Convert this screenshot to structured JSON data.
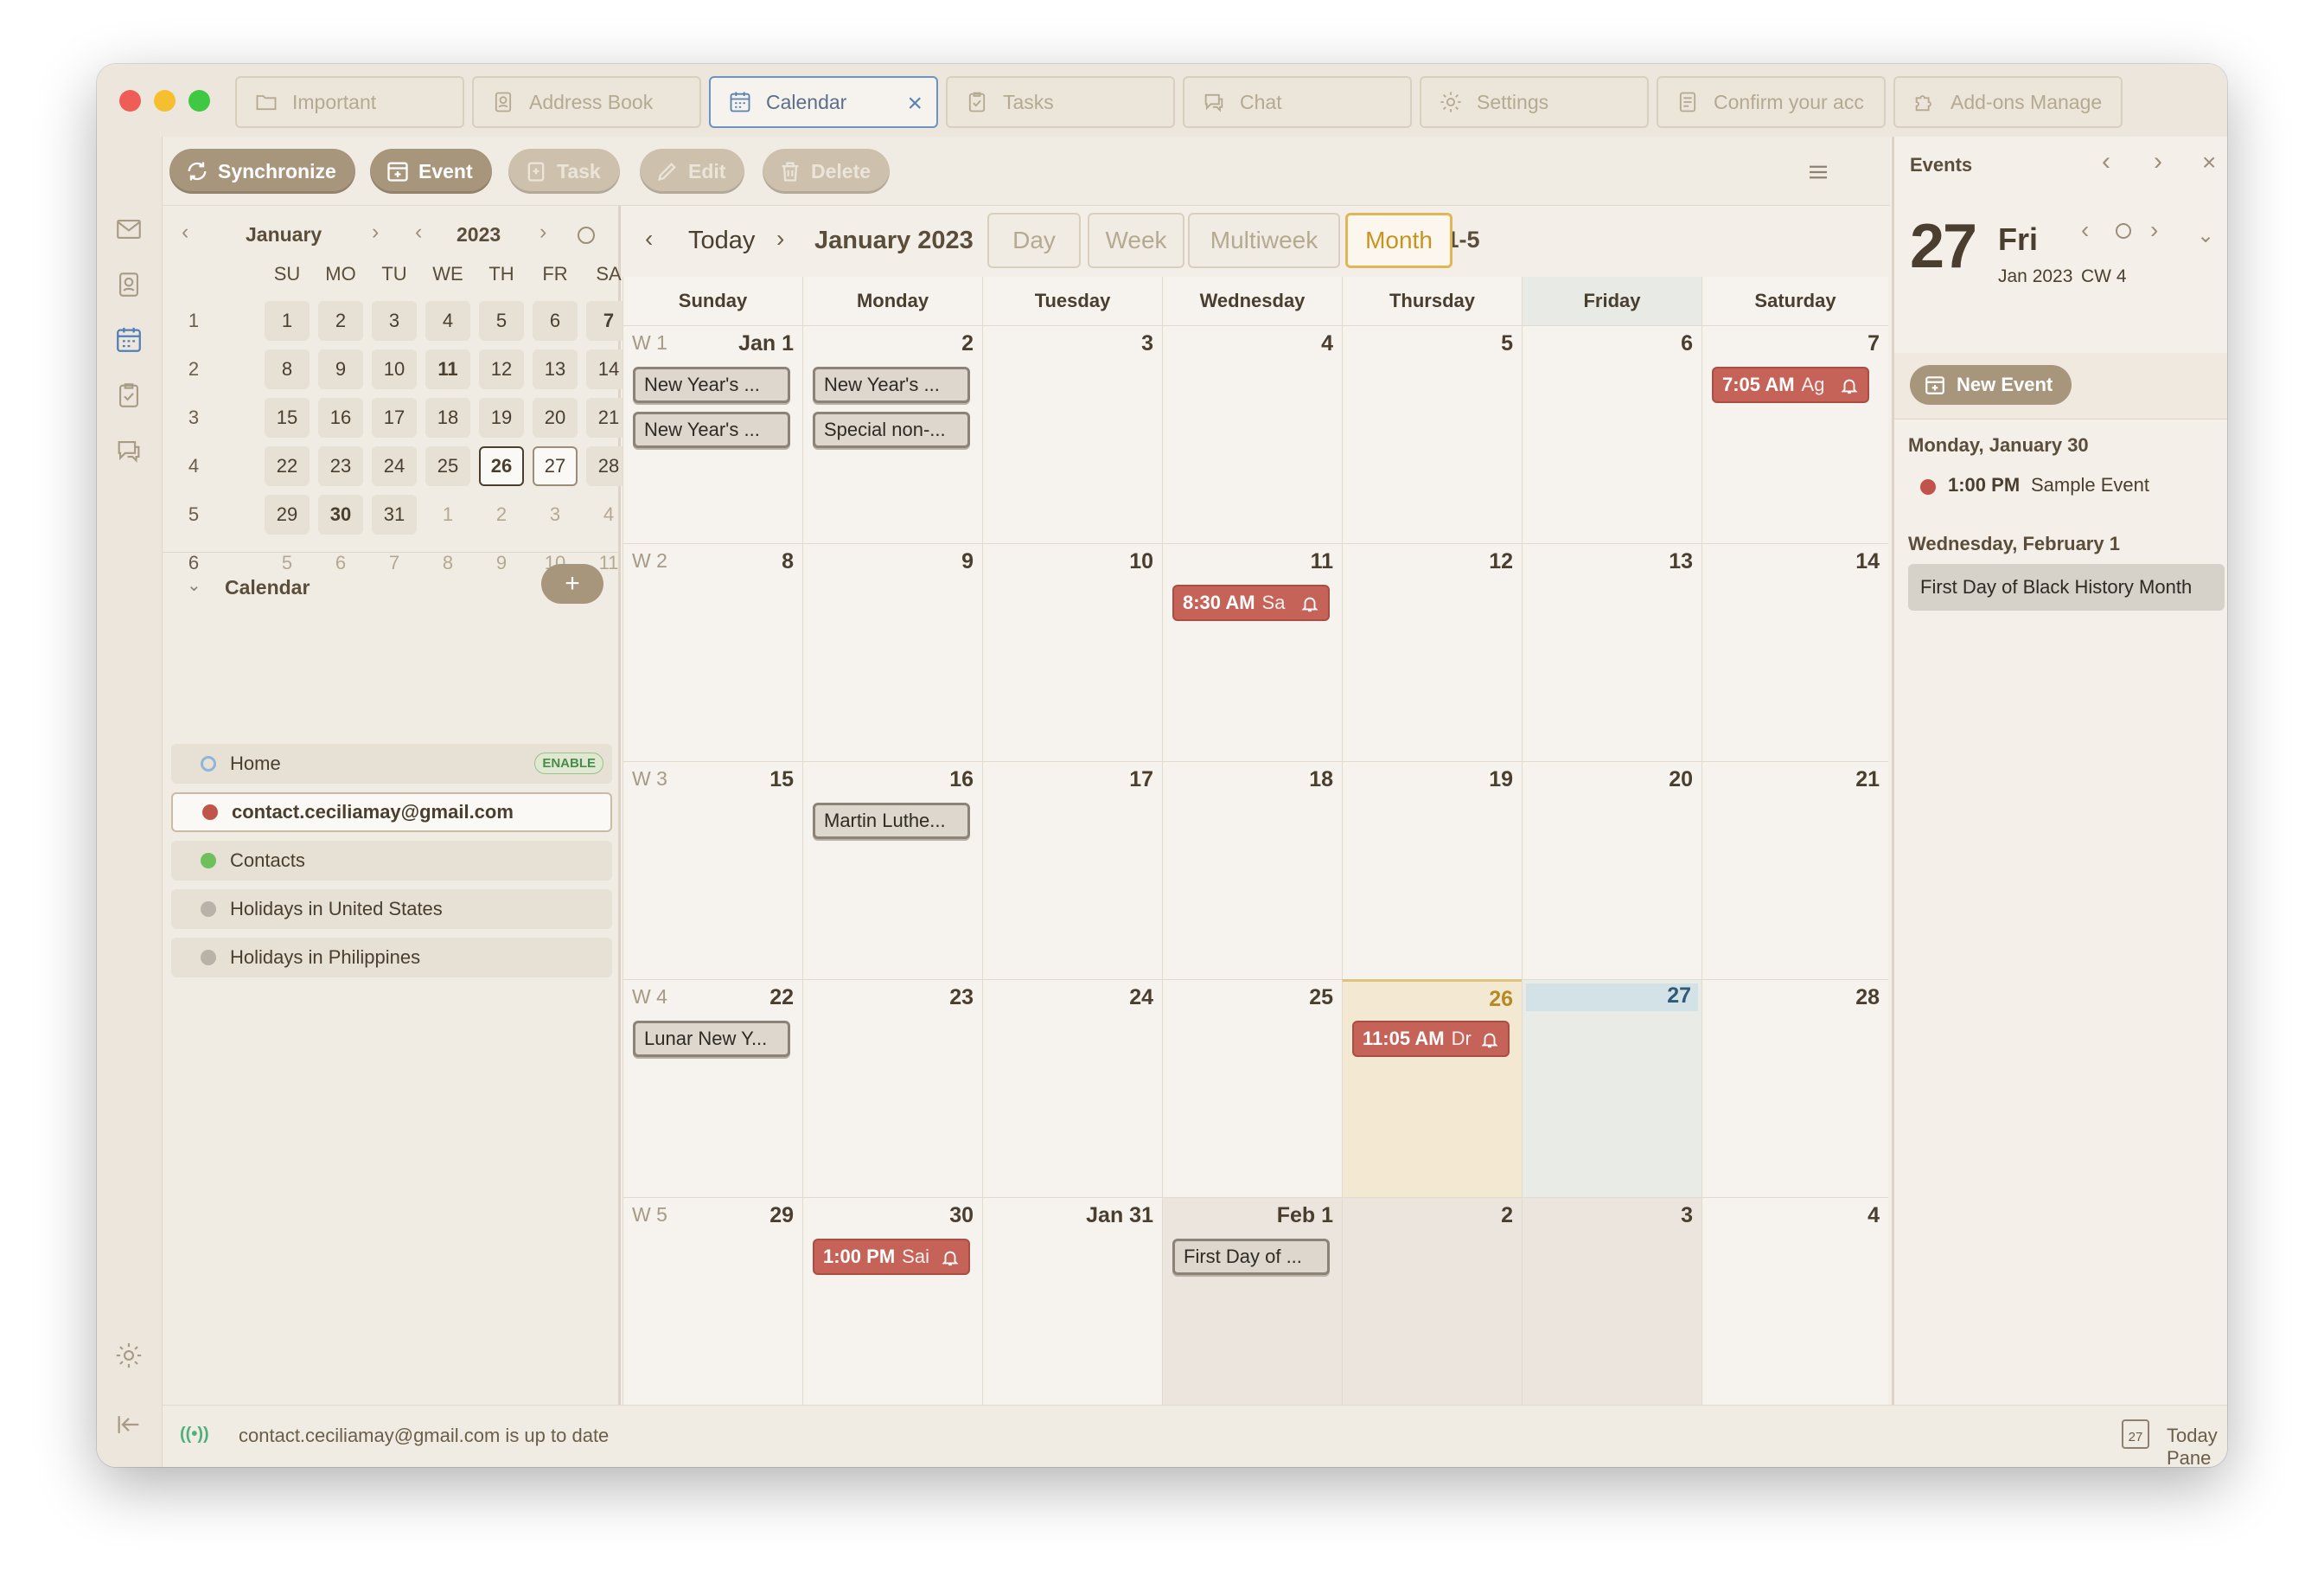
{
  "window": {
    "traffic_lights": [
      "#ee5e56",
      "#f5bf2f",
      "#3fc842"
    ]
  },
  "tabs": [
    {
      "label": "Important",
      "icon": "folder-icon"
    },
    {
      "label": "Address Book",
      "icon": "address-book-icon"
    },
    {
      "label": "Calendar",
      "icon": "calendar-icon",
      "active": true
    },
    {
      "label": "Tasks",
      "icon": "tasks-icon"
    },
    {
      "label": "Chat",
      "icon": "chat-icon"
    },
    {
      "label": "Settings",
      "icon": "gear-icon"
    },
    {
      "label": "Confirm your acc",
      "icon": "document-icon"
    },
    {
      "label": "Add-ons Manage",
      "icon": "puzzle-icon"
    }
  ],
  "toolbar": {
    "synchronize": "Synchronize",
    "event": "Event",
    "task": "Task",
    "edit": "Edit",
    "delete": "Delete"
  },
  "minimonth": {
    "month": "January",
    "year": "2023",
    "weekdays": [
      "SU",
      "MO",
      "TU",
      "WE",
      "TH",
      "FR",
      "SA"
    ],
    "weeks": [
      {
        "wk": "1",
        "days": [
          "1",
          "2",
          "3",
          "4",
          "5",
          "6",
          "7"
        ]
      },
      {
        "wk": "2",
        "days": [
          "8",
          "9",
          "10",
          "11",
          "12",
          "13",
          "14"
        ]
      },
      {
        "wk": "3",
        "days": [
          "15",
          "16",
          "17",
          "18",
          "19",
          "20",
          "21"
        ]
      },
      {
        "wk": "4",
        "days": [
          "22",
          "23",
          "24",
          "25",
          "26",
          "27",
          "28"
        ]
      },
      {
        "wk": "5",
        "days": [
          "29",
          "30",
          "31",
          "1",
          "2",
          "3",
          "4"
        ]
      },
      {
        "wk": "6",
        "days": [
          "5",
          "6",
          "7",
          "8",
          "9",
          "10",
          "11"
        ]
      }
    ]
  },
  "calendars": {
    "heading": "Calendar",
    "items": [
      {
        "name": "Home",
        "color": "#8fb6d6",
        "badge": "ENABLE"
      },
      {
        "name": "contact.ceciliamay@gmail.com",
        "color": "#c0544a"
      },
      {
        "name": "Contacts",
        "color": "#6fbf5a"
      },
      {
        "name": "Holidays in United States",
        "color": "#b8b2a8"
      },
      {
        "name": "Holidays in Philippines",
        "color": "#b8b2a8"
      }
    ]
  },
  "main": {
    "today": "Today",
    "title": "January 2023",
    "cws": "CWs: 1-5",
    "views": [
      "Day",
      "Week",
      "Multiweek",
      "Month"
    ],
    "active_view": "Month",
    "daynames": [
      "Sunday",
      "Monday",
      "Tuesday",
      "Wednesday",
      "Thursday",
      "Friday",
      "Saturday"
    ],
    "weeks": [
      {
        "label": "W 1",
        "days": [
          "Jan 1",
          "2",
          "3",
          "4",
          "5",
          "6",
          "7"
        ]
      },
      {
        "label": "W 2",
        "days": [
          "8",
          "9",
          "10",
          "11",
          "12",
          "13",
          "14"
        ]
      },
      {
        "label": "W 3",
        "days": [
          "15",
          "16",
          "17",
          "18",
          "19",
          "20",
          "21"
        ]
      },
      {
        "label": "W 4",
        "days": [
          "22",
          "23",
          "24",
          "25",
          "26",
          "27",
          "28"
        ]
      },
      {
        "label": "W 5",
        "days": [
          "29",
          "30",
          "Jan 31",
          "Feb 1",
          "2",
          "3",
          "4"
        ]
      }
    ],
    "events": [
      {
        "week": 0,
        "day": 0,
        "slot": 0,
        "type": "gray",
        "text": "New Year's ..."
      },
      {
        "week": 0,
        "day": 0,
        "slot": 1,
        "type": "gray",
        "text": "New Year's ..."
      },
      {
        "week": 0,
        "day": 1,
        "slot": 0,
        "type": "gray",
        "text": "New Year's ..."
      },
      {
        "week": 0,
        "day": 1,
        "slot": 1,
        "type": "gray",
        "text": "Special non-..."
      },
      {
        "week": 0,
        "day": 6,
        "slot": 0,
        "type": "red",
        "time": "7:05 AM",
        "text": "Ag"
      },
      {
        "week": 1,
        "day": 3,
        "slot": 0,
        "type": "red",
        "time": "8:30 AM",
        "text": "Sa"
      },
      {
        "week": 2,
        "day": 1,
        "slot": 0,
        "type": "gray",
        "text": "Martin Luthe..."
      },
      {
        "week": 3,
        "day": 0,
        "slot": 0,
        "type": "gray",
        "text": "Lunar New Y..."
      },
      {
        "week": 3,
        "day": 4,
        "slot": 0,
        "type": "red",
        "time": "11:05 AM",
        "text": "Dr"
      },
      {
        "week": 4,
        "day": 1,
        "slot": 0,
        "type": "red",
        "time": "1:00 PM",
        "text": "Sai"
      },
      {
        "week": 4,
        "day": 3,
        "slot": 0,
        "type": "gray",
        "text": "First Day of ..."
      }
    ]
  },
  "today_pane": {
    "title": "Events",
    "day": "27",
    "weekday": "Fri",
    "date": "Jan 2023",
    "cw": "CW 4",
    "new_event": "New Event",
    "groups": [
      {
        "date": "Monday, January 30",
        "time": "1:00 PM",
        "name": "Sample Event"
      },
      {
        "date": "Wednesday, February 1",
        "allday": "First Day of Black History Month"
      }
    ]
  },
  "status": {
    "text": "contact.ceciliamay@gmail.com is up to date",
    "today_pane": "Today Pane",
    "icon_day": "27"
  }
}
